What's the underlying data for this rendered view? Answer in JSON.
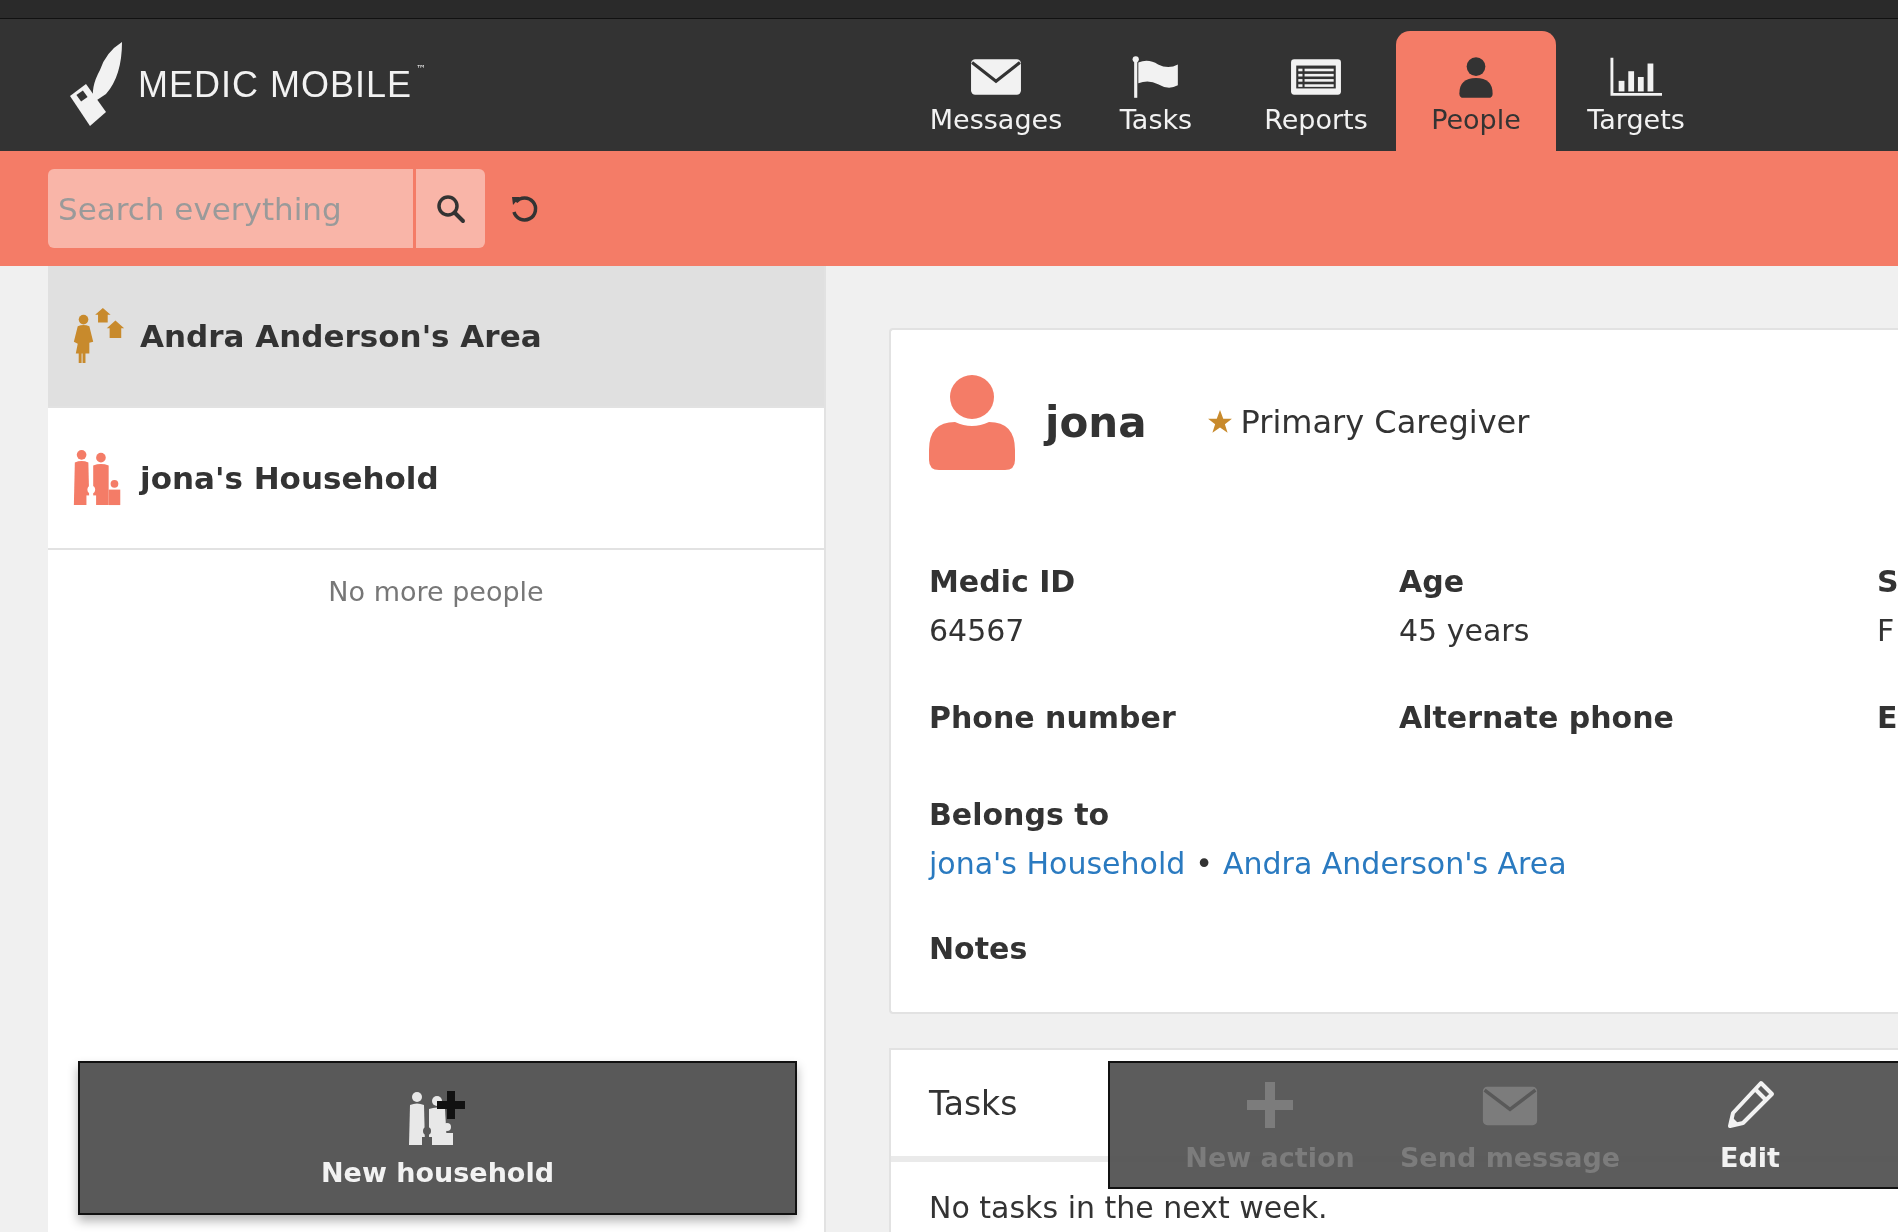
{
  "header": {
    "logo": "MEDIC MOBILE",
    "trademark": "™"
  },
  "nav_tabs": [
    {
      "label": "Messages",
      "kind": "messages",
      "selected": false
    },
    {
      "label": "Tasks",
      "kind": "tasks",
      "selected": false
    },
    {
      "label": "Reports",
      "kind": "reports",
      "selected": false
    },
    {
      "label": "People",
      "kind": "people",
      "selected": true
    },
    {
      "label": "Targets",
      "kind": "targets",
      "selected": false
    }
  ],
  "search": {
    "placeholder": "Search everything"
  },
  "contacts": [
    {
      "name": "Andra Anderson's Area",
      "kind": "area",
      "selected": true
    },
    {
      "name": "jona's Household",
      "kind": "household",
      "selected": false
    }
  ],
  "list_footer": "No more people",
  "new_button": {
    "label": "New household"
  },
  "person": {
    "name": "jona",
    "role": "Primary Caregiver",
    "fields": [
      {
        "label": "Medic ID",
        "value": "64567"
      },
      {
        "label": "Age",
        "value": "45 years"
      },
      {
        "label": "S",
        "value": "F"
      },
      {
        "label": "Phone number"
      },
      {
        "label": "Alternate phone"
      },
      {
        "label": "E"
      }
    ],
    "belongs_to": {
      "label": "Belongs to",
      "links": [
        "jona's Household",
        "Andra Anderson's Area"
      ],
      "separator": "•"
    },
    "notes": {
      "label": "Notes"
    }
  },
  "tasks": {
    "title": "Tasks",
    "empty": "No tasks in the next week."
  },
  "actions": [
    {
      "label": "New action",
      "kind": "add",
      "disabled": true
    },
    {
      "label": "Send message",
      "kind": "message",
      "disabled": true
    },
    {
      "label": "Edit",
      "kind": "edit",
      "disabled": false
    }
  ]
}
